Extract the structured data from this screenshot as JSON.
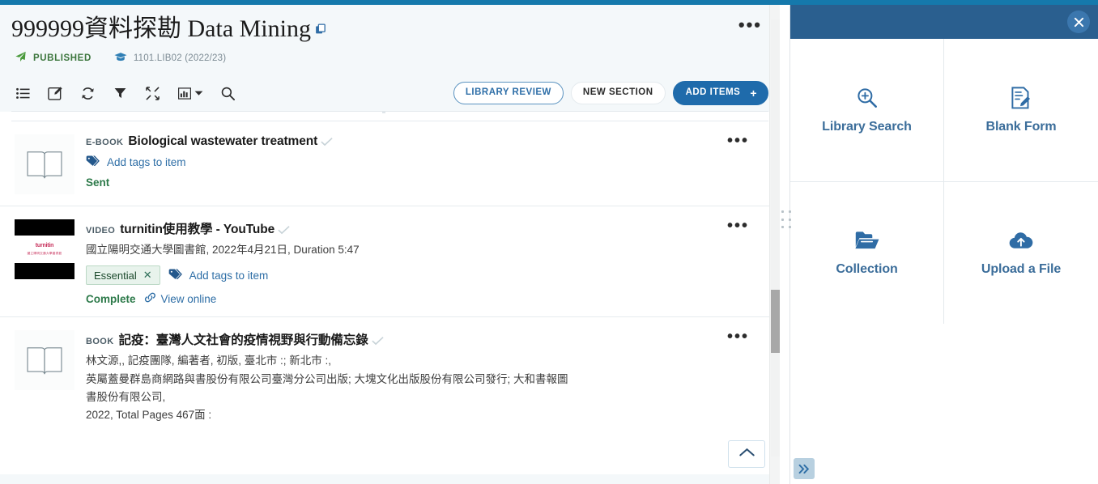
{
  "top_accent_color": "#1579ac",
  "header": {
    "title": "999999資料探勘 Data Mining",
    "copy_icon": "copy-icon",
    "status_label": "PUBLISHED",
    "status_icon": "paper-plane-icon",
    "course_icon": "graduation-cap-icon",
    "course_code": "1101.LIB02 (2022/23)",
    "more_menu": "•••"
  },
  "toolbar": {
    "icons": [
      {
        "name": "list-view-icon",
        "glyph": "list"
      },
      {
        "name": "edit-icon",
        "glyph": "edit"
      },
      {
        "name": "refresh-icon",
        "glyph": "refresh"
      },
      {
        "name": "filter-icon",
        "glyph": "filter"
      },
      {
        "name": "collapse-icon",
        "glyph": "collapse"
      },
      {
        "name": "analytics-icon",
        "glyph": "chart"
      },
      {
        "name": "search-icon",
        "glyph": "search"
      }
    ],
    "library_review_label": "LIBRARY REVIEW",
    "new_section_label": "NEW SECTION",
    "add_items_label": "ADD ITEMS",
    "add_items_plus": "+"
  },
  "items": [
    {
      "kind": "E-BOOK",
      "title": "Biological wastewater treatment",
      "thumb": "book-icon",
      "meta": "",
      "tags": [],
      "add_tags_label": "Add tags to item",
      "status": "Sent",
      "status_color": "#2d7a4a",
      "link_label": "",
      "more_menu": "•••"
    },
    {
      "kind": "VIDEO",
      "title": "turnitin使用教學 - YouTube",
      "thumb": "video-thumbnail",
      "thumb_logo": "turnitin",
      "thumb_sub": "國立陽明交通大學圖書館",
      "meta": "國立陽明交通大學圖書館, 2022年4月21日, Duration 5:47",
      "tags": [
        {
          "label": "Essential",
          "remove": "✕"
        }
      ],
      "add_tags_label": "Add tags to item",
      "status": "Complete",
      "status_color": "#2d7a4a",
      "link_label": "View online",
      "link_icon": "link-icon",
      "more_menu": "•••"
    },
    {
      "kind": "BOOK",
      "title": "記疫：臺灣人文社會的疫情視野與行動備忘錄",
      "thumb": "book-icon",
      "meta_lines": [
        "林文源,, 記疫團隊, 編著者, 初版, 臺北市 :; 新北市 :,",
        "英屬蓋曼群島商網路與書股份有限公司臺灣分公司出版; 大塊文化出版股份有限公司發行; 大和書報圖",
        "書股份有限公司,",
        "2022, Total Pages 467面 :"
      ],
      "tags": [],
      "add_tags_label": "",
      "status": "",
      "link_label": "",
      "more_menu": "•••"
    }
  ],
  "scroll_to_top_icon": "chevron-up-icon",
  "panel": {
    "close_icon": "close-icon",
    "header_color": "#2a5f8f",
    "accent_color": "#3b6d9a",
    "cards": [
      {
        "label": "Library Search",
        "icon": "search-plus-icon"
      },
      {
        "label": "Blank Form",
        "icon": "form-edit-icon"
      },
      {
        "label": "Collection",
        "icon": "folder-open-icon"
      },
      {
        "label": "Upload a File",
        "icon": "cloud-upload-icon"
      }
    ],
    "drag_handle": "drag-handle",
    "expand_icon": "double-chevron-right-icon"
  }
}
